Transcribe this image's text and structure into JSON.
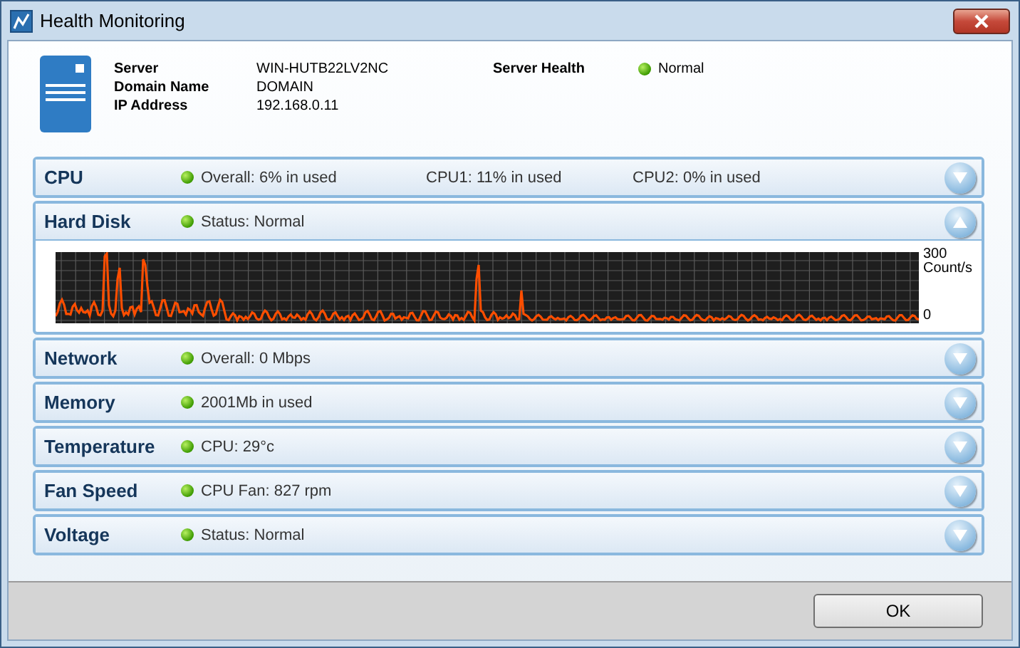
{
  "window": {
    "title": "Health Monitoring"
  },
  "server": {
    "fields": [
      {
        "label": "Server",
        "value": "WIN-HUTB22LV2NC"
      },
      {
        "label": "Domain Name",
        "value": "DOMAIN"
      },
      {
        "label": "IP Address",
        "value": "192.168.0.11"
      }
    ],
    "health": {
      "label": "Server Health",
      "value": "Normal"
    }
  },
  "sections": [
    {
      "name": "CPU",
      "expanded": false,
      "readings": [
        "Overall: 6% in used",
        "CPU1: 11% in used",
        "CPU2: 0% in used"
      ]
    },
    {
      "name": "Hard Disk",
      "expanded": true,
      "readings": [
        "Status: Normal"
      ],
      "chart": {
        "max_label": "300",
        "unit": "Count/s",
        "min_label": "0"
      }
    },
    {
      "name": "Network",
      "expanded": false,
      "readings": [
        "Overall: 0 Mbps"
      ]
    },
    {
      "name": "Memory",
      "expanded": false,
      "readings": [
        "2001Mb in used"
      ]
    },
    {
      "name": "Temperature",
      "expanded": false,
      "readings": [
        "CPU: 29°c"
      ]
    },
    {
      "name": "Fan Speed",
      "expanded": false,
      "readings": [
        "CPU Fan: 827 rpm"
      ]
    },
    {
      "name": "Voltage",
      "expanded": false,
      "readings": [
        "Status: Normal"
      ]
    }
  ],
  "buttons": [
    "OK"
  ]
}
